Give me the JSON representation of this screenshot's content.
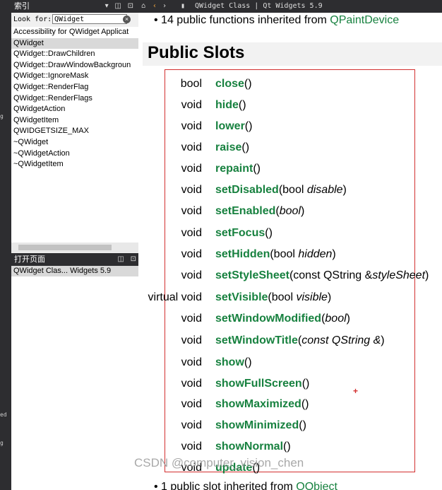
{
  "left_strip": {
    "ticks": [
      "g",
      "ed",
      "g"
    ]
  },
  "index_panel": {
    "title": "索引",
    "look_for_label": "Look for:",
    "look_for_value": "QWidget",
    "items": [
      "Accessibility for QWidget Applicat",
      "QWidget",
      "QWidget::DrawChildren",
      "QWidget::DrawWindowBackgroun",
      "QWidget::IgnoreMask",
      "QWidget::RenderFlag",
      "QWidget::RenderFlags",
      "QWidgetAction",
      "QWidgetItem",
      "QWIDGETSIZE_MAX",
      "~QWidget",
      "~QWidgetAction",
      "~QWidgetItem"
    ],
    "selected_index": 1
  },
  "open_pages_panel": {
    "title": "打开页面",
    "items": [
      "QWidget Clas... Widgets 5.9"
    ]
  },
  "tab_strip": {
    "title": "QWidget Class | Qt Widgets 5.9"
  },
  "content": {
    "inherited_functions": {
      "text": "14 public functions inherited from ",
      "link": "QPaintDevice"
    },
    "section_title": "Public Slots",
    "slots": [
      {
        "ret": "bool",
        "name": "close",
        "pre": "(",
        "params": "",
        "italic": "",
        "post": ")"
      },
      {
        "ret": "void",
        "name": "hide",
        "pre": "(",
        "params": "",
        "italic": "",
        "post": ")"
      },
      {
        "ret": "void",
        "name": "lower",
        "pre": "(",
        "params": "",
        "italic": "",
        "post": ")"
      },
      {
        "ret": "void",
        "name": "raise",
        "pre": "(",
        "params": "",
        "italic": "",
        "post": ")"
      },
      {
        "ret": "void",
        "name": "repaint",
        "pre": "(",
        "params": "",
        "italic": "",
        "post": ")"
      },
      {
        "ret": "void",
        "name": "setDisabled",
        "pre": "(",
        "params": "bool ",
        "italic": "disable",
        "post": ")"
      },
      {
        "ret": "void",
        "name": "setEnabled",
        "pre": "(",
        "params": "",
        "italic": "bool",
        "post": ")"
      },
      {
        "ret": "void",
        "name": "setFocus",
        "pre": "(",
        "params": "",
        "italic": "",
        "post": ")"
      },
      {
        "ret": "void",
        "name": "setHidden",
        "pre": "(",
        "params": "bool ",
        "italic": "hidden",
        "post": ")"
      },
      {
        "ret": "void",
        "name": "setStyleSheet",
        "pre": "(",
        "params": "const QString &",
        "italic": "styleSheet",
        "post": ")"
      },
      {
        "ret": "virtual void",
        "name": "setVisible",
        "pre": "(",
        "params": "bool ",
        "italic": "visible",
        "post": ")"
      },
      {
        "ret": "void",
        "name": "setWindowModified",
        "pre": "(",
        "params": "",
        "italic": "bool",
        "post": ")"
      },
      {
        "ret": "void",
        "name": "setWindowTitle",
        "pre": "(",
        "params": "",
        "italic": "const QString &",
        "post": ")"
      },
      {
        "ret": "void",
        "name": "show",
        "pre": "(",
        "params": "",
        "italic": "",
        "post": ")"
      },
      {
        "ret": "void",
        "name": "showFullScreen",
        "pre": "(",
        "params": "",
        "italic": "",
        "post": ")"
      },
      {
        "ret": "void",
        "name": "showMaximized",
        "pre": "(",
        "params": "",
        "italic": "",
        "post": ")"
      },
      {
        "ret": "void",
        "name": "showMinimized",
        "pre": "(",
        "params": "",
        "italic": "",
        "post": ")"
      },
      {
        "ret": "void",
        "name": "showNormal",
        "pre": "(",
        "params": "",
        "italic": "",
        "post": ")"
      },
      {
        "ret": "void",
        "name": "update",
        "pre": "(",
        "params": "",
        "italic": "",
        "post": ")"
      }
    ],
    "inherited_slots": {
      "text": "1 public slot inherited from ",
      "link": "QObject"
    },
    "cursor_mark": "+"
  },
  "watermark": "CSDN @computer_vision_chen",
  "colors": {
    "link": "#17813f",
    "highlight_box": "#d32f2f",
    "panel_header": "#2d2d30"
  }
}
